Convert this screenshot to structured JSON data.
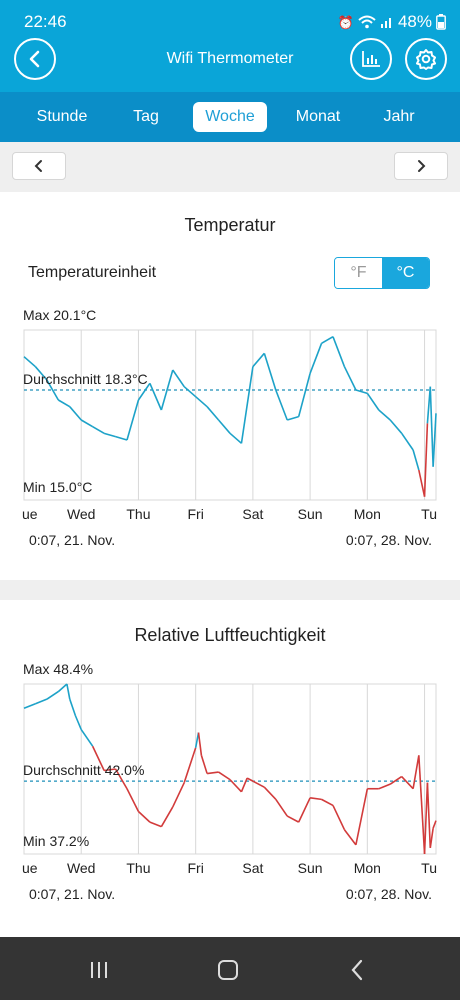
{
  "status": {
    "time": "22:46",
    "battery": "48%"
  },
  "header": {
    "title": "Wifi Thermometer"
  },
  "tabs": [
    {
      "label": "Stunde",
      "active": false
    },
    {
      "label": "Tag",
      "active": false
    },
    {
      "label": "Woche",
      "active": true
    },
    {
      "label": "Monat",
      "active": false
    },
    {
      "label": "Jahr",
      "active": false
    }
  ],
  "temperature": {
    "title": "Temperatur",
    "unit_label": "Temperatureinheit",
    "unit_f": "°F",
    "unit_c": "°C",
    "selected_unit": "°C"
  },
  "humidity": {
    "title": "Relative Luftfeuchtigkeit"
  },
  "chart_data": [
    {
      "type": "line",
      "title": "Temperatur",
      "series": [
        {
          "color": "#1da2c8",
          "min_color": "#d23b3b",
          "x": [
            0,
            0.2,
            0.4,
            0.6,
            0.8,
            1.0,
            1.2,
            1.4,
            1.6,
            1.8,
            2.0,
            2.2,
            2.4,
            2.6,
            2.8,
            3.0,
            3.2,
            3.4,
            3.6,
            3.8,
            4.0,
            4.2,
            4.4,
            4.6,
            4.8,
            5.0,
            5.2,
            5.4,
            5.6,
            5.8,
            6.0,
            6.2,
            6.4,
            6.6,
            6.8,
            6.9,
            7.0,
            7.05,
            7.1,
            7.15,
            7.2
          ],
          "y": [
            19.3,
            19.0,
            18.6,
            18.0,
            17.8,
            17.4,
            17.2,
            17.0,
            16.9,
            16.8,
            18.0,
            18.5,
            17.7,
            18.9,
            18.4,
            18.1,
            17.8,
            17.4,
            17.0,
            16.7,
            19.0,
            19.4,
            18.3,
            17.4,
            17.5,
            18.8,
            19.7,
            19.9,
            19.0,
            18.3,
            18.2,
            17.7,
            17.4,
            17.0,
            16.5,
            15.9,
            15.1,
            17.3,
            18.4,
            16.0,
            17.6
          ]
        }
      ],
      "x_ticks": [
        "Tue",
        "Wed",
        "Thu",
        "Fri",
        "Sat",
        "Sun",
        "Mon",
        "Tu"
      ],
      "x_tick_labels": [
        "ue",
        "Wed",
        "Thu",
        "Fri",
        "Sat",
        "Sun",
        "Mon",
        "Tu"
      ],
      "ylim": [
        15.0,
        20.1
      ],
      "average": 18.3,
      "max_label": "Max 20.1°C",
      "avg_label": "Durchschnitt 18.3°C",
      "min_label": "Min 15.0°C",
      "range_start": "0:07,  21. Nov.",
      "range_end": "0:07,  28. Nov.",
      "grid": true
    },
    {
      "type": "line",
      "title": "Relative Luftfeuchtigkeit",
      "series": [
        {
          "color": "#1da2c8",
          "low_color": "#d23b3b",
          "x": [
            0,
            0.2,
            0.4,
            0.6,
            0.75,
            0.8,
            0.9,
            1.0,
            1.2,
            1.4,
            1.6,
            1.8,
            2.0,
            2.2,
            2.4,
            2.6,
            2.8,
            3.0,
            3.05,
            3.1,
            3.2,
            3.4,
            3.6,
            3.8,
            3.9,
            4.0,
            4.2,
            4.4,
            4.6,
            4.8,
            5.0,
            5.2,
            5.4,
            5.6,
            5.8,
            6.0,
            6.2,
            6.4,
            6.6,
            6.8,
            6.9,
            7.0,
            7.05,
            7.1,
            7.15,
            7.2
          ],
          "y": [
            46.8,
            47.1,
            47.4,
            47.9,
            48.4,
            47.4,
            46.3,
            45.4,
            44.3,
            42.7,
            42.8,
            41.5,
            40.0,
            39.3,
            39.0,
            40.3,
            41.9,
            44.2,
            45.2,
            43.7,
            42.5,
            42.6,
            42.1,
            41.3,
            42.2,
            42.0,
            41.6,
            40.8,
            39.7,
            39.3,
            40.9,
            40.8,
            40.4,
            38.8,
            37.8,
            41.5,
            41.5,
            41.8,
            42.3,
            41.5,
            43.7,
            37.2,
            41.9,
            37.6,
            38.9,
            39.4
          ]
        }
      ],
      "x_ticks": [
        "Tue",
        "Wed",
        "Thu",
        "Fri",
        "Sat",
        "Sun",
        "Mon",
        "Tu"
      ],
      "x_tick_labels": [
        "ue",
        "Wed",
        "Thu",
        "Fri",
        "Sat",
        "Sun",
        "Mon",
        "Tu"
      ],
      "ylim": [
        37.2,
        48.4
      ],
      "average": 42.0,
      "max_label": "Max 48.4%",
      "avg_label": "Durchschnitt 42.0%",
      "min_label": "Min 37.2%",
      "range_start": "0:07,  21. Nov.",
      "range_end": "0:07,  28. Nov.",
      "grid": true
    }
  ]
}
